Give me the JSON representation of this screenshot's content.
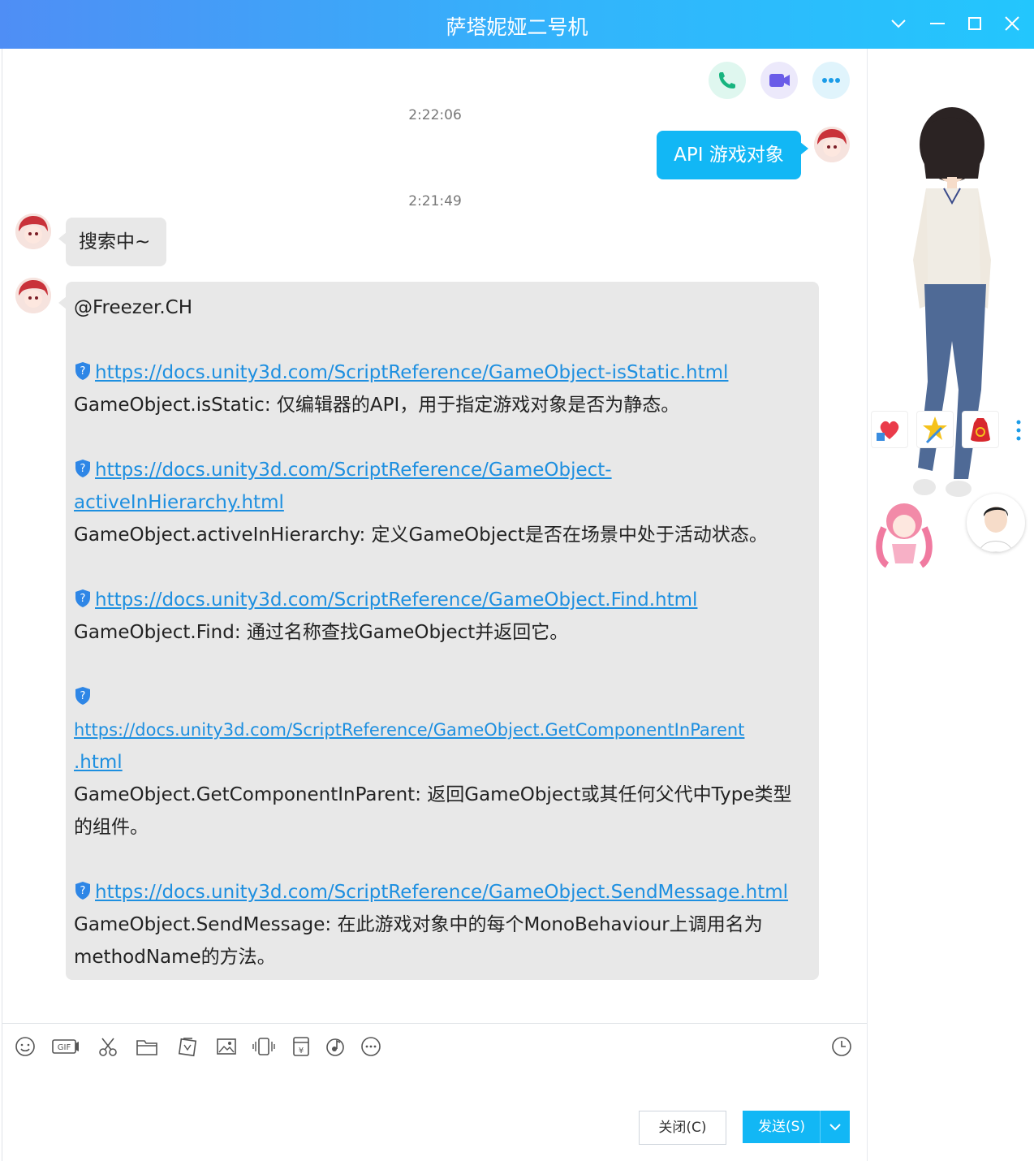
{
  "window": {
    "title": "萨塔妮娅二号机"
  },
  "header_actions": {
    "call": "voice-call",
    "video": "video-call",
    "more": "more"
  },
  "messages": [
    {
      "time": "2:22:06",
      "side": "right",
      "text": "API 游戏对象"
    },
    {
      "time": "2:21:49",
      "side": "left",
      "text": "搜索中~"
    },
    {
      "side": "left",
      "mention": "@Freezer.CH",
      "items": [
        {
          "url_lines": [
            "https://docs.unity3d.com/ScriptReference/GameObject-isStatic.html"
          ],
          "desc_lines": [
            "GameObject.isStatic: 仅编辑器的API，用于指定游戏对象是否为静态。"
          ]
        },
        {
          "url_lines": [
            "https://docs.unity3d.com/ScriptReference/GameObject-",
            "activeInHierarchy.html"
          ],
          "desc_lines": [
            "GameObject.activeInHierarchy: 定义GameObject是否在场景中处于活动状态。"
          ]
        },
        {
          "url_lines": [
            "https://docs.unity3d.com/ScriptReference/GameObject.Find.html"
          ],
          "desc_lines": [
            "GameObject.Find: 通过名称查找GameObject并返回它。"
          ]
        },
        {
          "url_lines": [
            "https://docs.unity3d.com/ScriptReference/GameObject.GetComponentInParent",
            ".html"
          ],
          "desc_lines": [
            "GameObject.GetComponentInParent: 返回GameObject或其任何父代中Type类型",
            "的组件。"
          ]
        },
        {
          "url_lines": [
            "https://docs.unity3d.com/ScriptReference/GameObject.SendMessage.html"
          ],
          "desc_lines": [
            "GameObject.SendMessage: 在此游戏对象中的每个MonoBehaviour上调用名为",
            "methodName的方法。"
          ]
        }
      ]
    }
  ],
  "footer": {
    "close_label": "关闭(C)",
    "send_label": "发送(S)"
  },
  "colors": {
    "accent": "#12b7f5",
    "bubble_gray": "#e8e8e8",
    "link": "#1d8fe0"
  }
}
